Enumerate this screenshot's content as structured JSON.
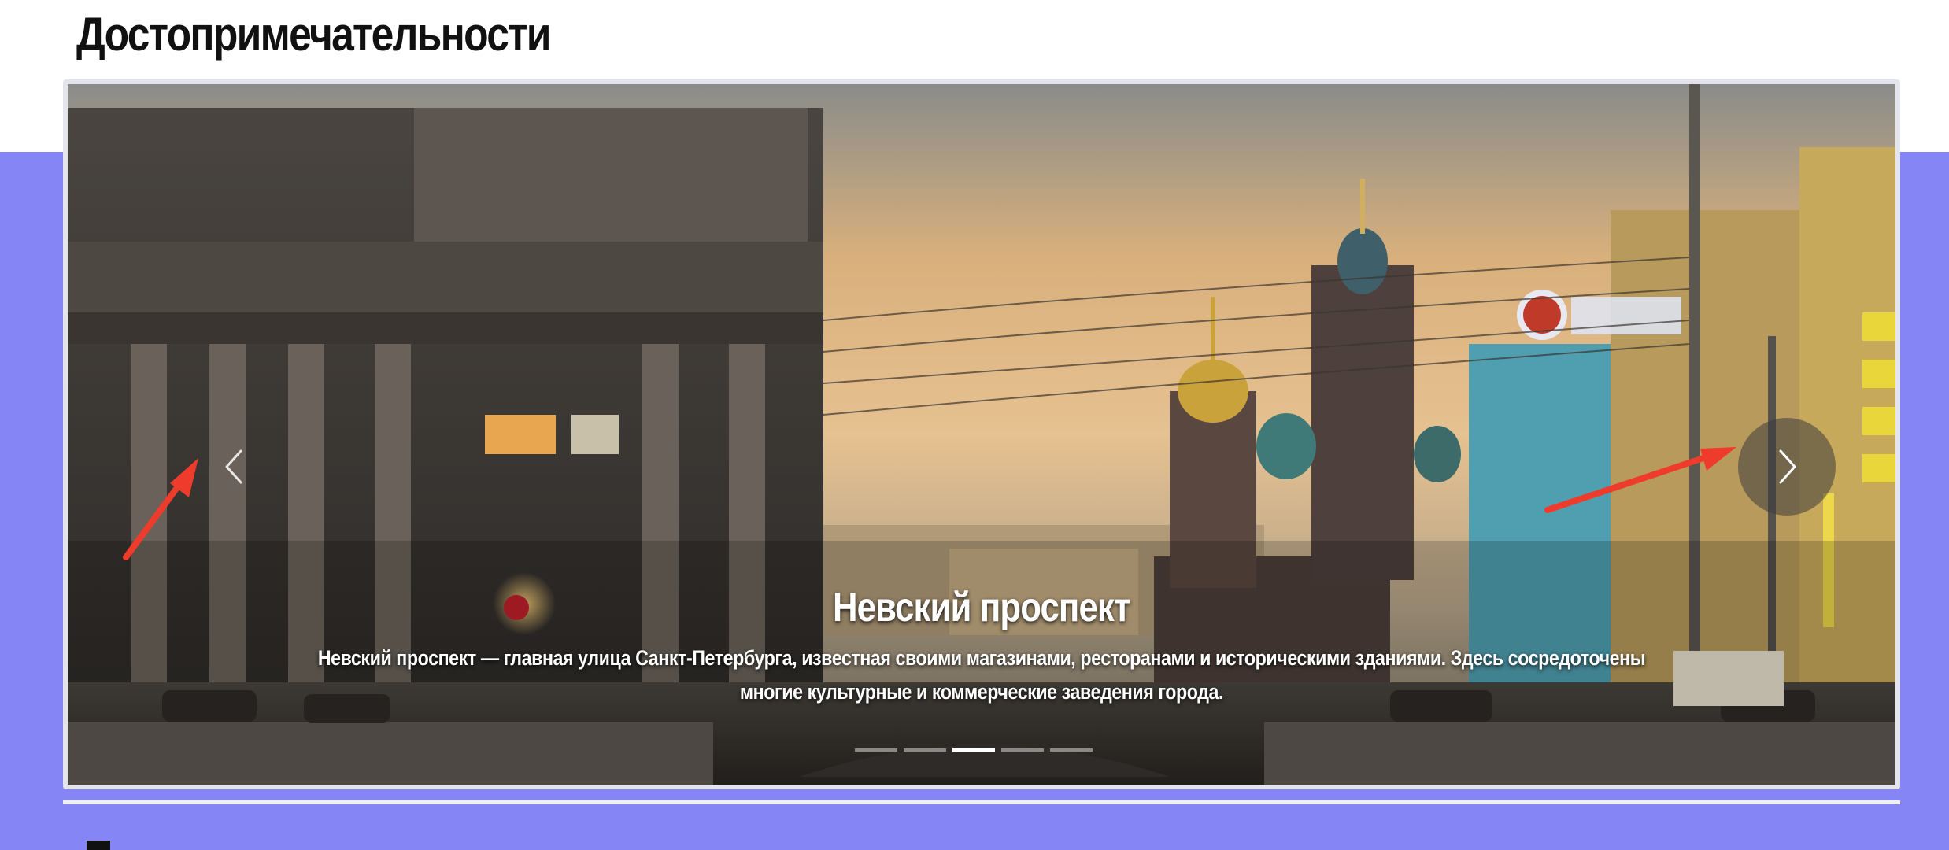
{
  "section": {
    "title": "Достопримечательности"
  },
  "carousel": {
    "slides": [
      {
        "title": "Невский проспект",
        "text": "Невский проспект — главная улица Санкт-Петербурга, известная своими магазинами, ресторанами и историческими зданиями. Здесь сосредоточены многие культурные и коммерческие заведения города."
      }
    ],
    "indicator_count": 5,
    "active_indicator": 3,
    "prev_icon": "chevron-left-icon",
    "next_icon": "chevron-right-icon"
  },
  "colors": {
    "band": "#8585f5",
    "annotation_arrow": "#ee3b2c"
  }
}
